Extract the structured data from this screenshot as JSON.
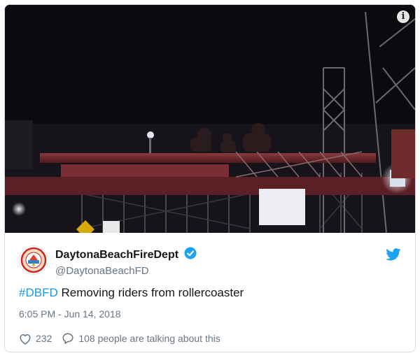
{
  "tweet": {
    "display_name": "DaytonaBeachFireDept",
    "handle": "@DaytonaBeachFD",
    "hashtag": "#DBFD",
    "text": " Removing riders from rollercoaster",
    "timestamp": "6:05 PM - Jun 14, 2018",
    "likes": "232",
    "conversation": "108 people are talking about this"
  },
  "icons": {
    "info": "info-icon",
    "verified": "verified-badge-icon",
    "brand": "twitter-bird-icon",
    "like": "heart-icon",
    "reply": "speech-bubble-icon"
  },
  "colors": {
    "link": "#1b95e0",
    "verified": "#1da1f2",
    "text": "#14171a",
    "muted": "#657786"
  }
}
